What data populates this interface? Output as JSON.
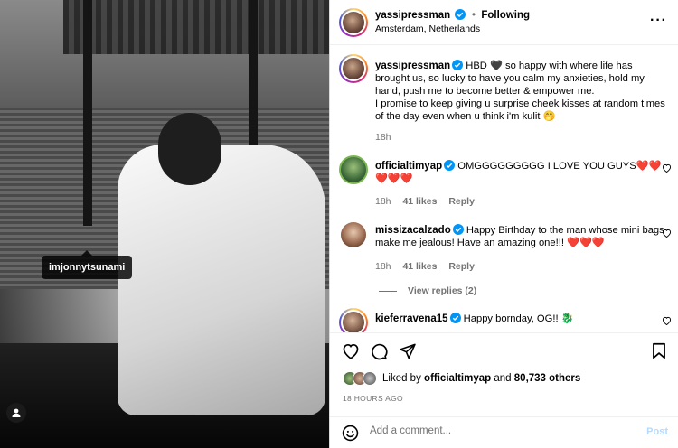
{
  "photo": {
    "tag_username": "imjonnytsunami"
  },
  "header": {
    "username": "yassipressman",
    "separator": "•",
    "follow_label": "Following",
    "location": "Amsterdam, Netherlands",
    "more_icon": "more-options-icon"
  },
  "caption": {
    "username": "yassipressman",
    "text_1": "HBD 🖤 so happy with where life has brought us, so lucky to have you calm my anxieties, hold my hand, push me to become better & empower me.",
    "text_2": "I promise to keep giving u surprise cheek kisses at random times of the day even when u think i'm kulit 🤭",
    "time": "18h"
  },
  "comments": [
    {
      "username": "officialtimyap",
      "text": "OMGGGGGGGGG I LOVE YOU GUYS",
      "hearts_inline": "❤️❤️",
      "hearts_line2": "❤️❤️❤️",
      "time": "18h",
      "likes": "41 likes",
      "reply": "Reply"
    },
    {
      "username": "missizacalzado",
      "text": "Happy Birthday to the man whose mini bags make me jealous! Have an amazing one!!! ❤️❤️❤️",
      "time": "18h",
      "likes": "41 likes",
      "reply": "Reply",
      "view_replies": "View replies (2)"
    },
    {
      "username": "kieferravena15",
      "text": "Happy bornday, OG!! 🐉"
    }
  ],
  "actions": {
    "liked_by_prefix": "Liked by",
    "liked_by_user": "officialtimyap",
    "and": "and",
    "others": "80,733 others",
    "timestamp": "18 HOURS AGO"
  },
  "composer": {
    "placeholder": "Add a comment...",
    "post_label": "Post"
  },
  "colors": {
    "verified": "#0095f6",
    "muted": "#737373",
    "post_disabled": "#b3dbff"
  }
}
